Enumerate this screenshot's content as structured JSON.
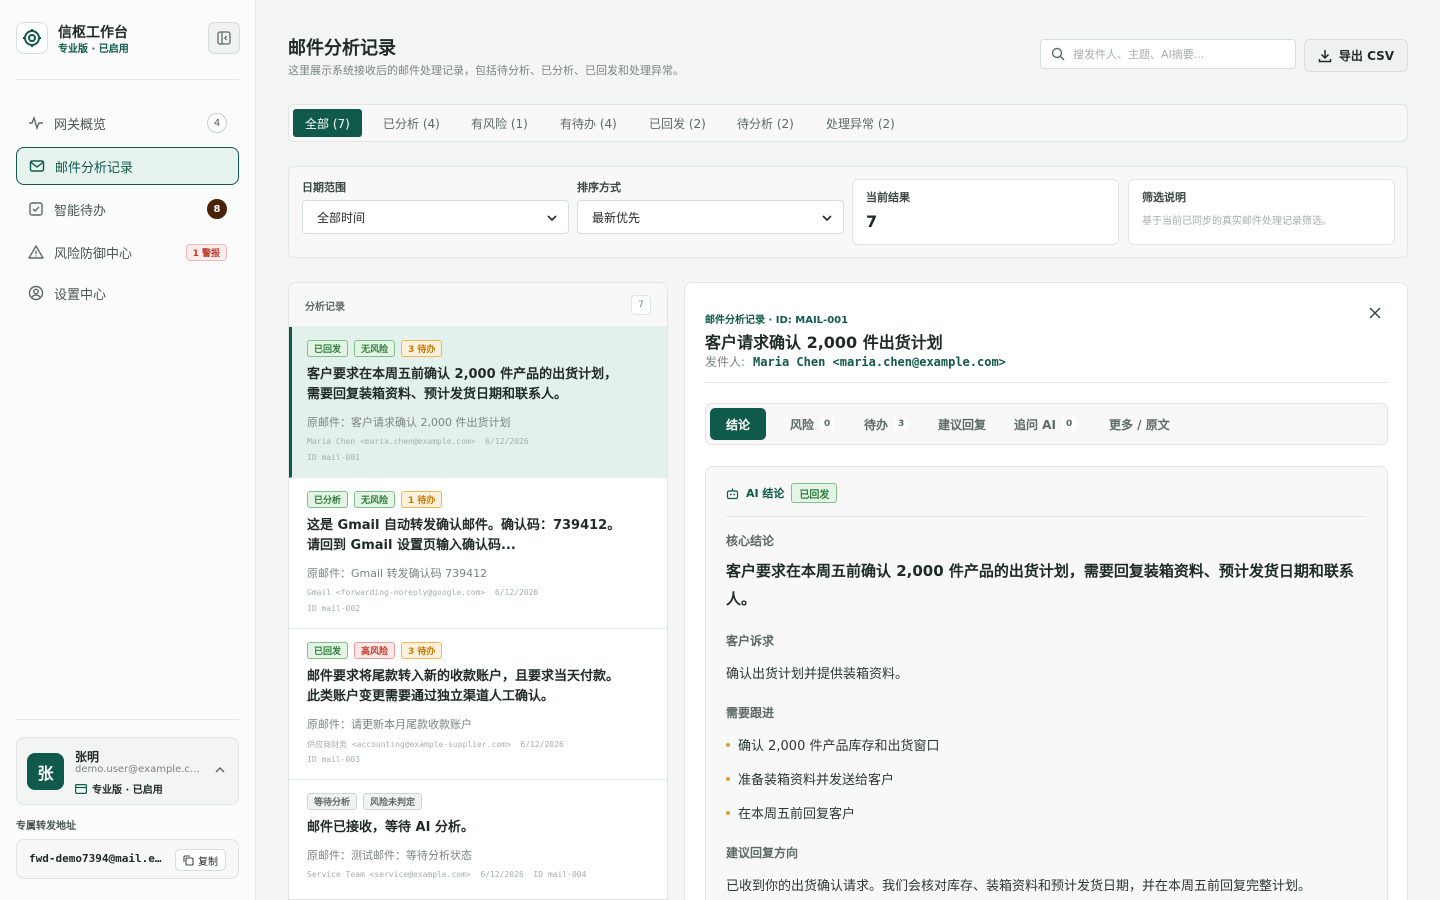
{
  "sidebar": {
    "brand_name": "信枢工作台",
    "brand_plan": "专业版 · 已启用",
    "nav": [
      {
        "label": "网关概览",
        "count": "4"
      },
      {
        "label": "邮件分析记录"
      },
      {
        "label": "智能待办",
        "count": "8"
      },
      {
        "label": "风险防御中心",
        "alert": "1 警报"
      },
      {
        "label": "设置中心"
      }
    ],
    "user": {
      "avatar": "张",
      "name": "张明",
      "email": "demo.user@example.com",
      "plan": "专业版 · 已启用"
    },
    "forward_label": "专属转发地址",
    "forward_address": "fwd-demo7394@mail.example.com",
    "copy_label": "复制"
  },
  "header": {
    "title": "邮件分析记录",
    "description": "这里展示系统接收后的邮件处理记录，包括待分析、已分析、已回发和处理异常。",
    "search_placeholder": "搜发件人、主题、AI摘要...",
    "export_label": "导出 CSV"
  },
  "tabs": [
    "全部 (7)",
    "已分析 (4)",
    "有风险 (1)",
    "有待办 (4)",
    "已回发 (2)",
    "待分析 (2)",
    "处理异常 (2)"
  ],
  "filters": {
    "date_label": "日期范围",
    "date_value": "全部时间",
    "sort_label": "排序方式",
    "sort_value": "最新优先",
    "result_label": "当前结果",
    "result_value": "7",
    "note_label": "筛选说明",
    "note_value": "基于当前已同步的真实邮件处理记录筛选。"
  },
  "list": {
    "title": "分析记录",
    "count": "7",
    "records": [
      {
        "badges": [
          "已回发",
          "无风险",
          "3 待办"
        ],
        "title": "客户要求在本周五前确认 2,000 件产品的出货计划，需要回复装箱资料、预计发货日期和联系人。",
        "original": "原邮件：客户请求确认 2,000 件出货计划",
        "sender": "Maria Chen <maria.chen@example.com>",
        "date": "6/12/2026",
        "id": "ID mail-001"
      },
      {
        "badges": [
          "已分析",
          "无风险",
          "1 待办"
        ],
        "title": "这是 Gmail 自动转发确认邮件。确认码：739412。请回到 Gmail 设置页输入确认码...",
        "original": "原邮件：Gmail 转发确认码 739412",
        "sender": "Gmail <forwarding-noreply@google.com>",
        "date": "6/12/2026",
        "id": "ID mail-002"
      },
      {
        "badges": [
          "已回发",
          "高风险",
          "3 待办"
        ],
        "title": "邮件要求将尾款转入新的收款账户，且要求当天付款。此类账户变更需要通过独立渠道人工确认。",
        "original": "原邮件：请更新本月尾款收款账户",
        "sender": "供应商财务 <accounting@example-supplier.com>",
        "date": "6/12/2026",
        "id": "ID mail-003"
      },
      {
        "badges": [
          "等待分析",
          "风险未判定"
        ],
        "title": "邮件已接收，等待 AI 分析。",
        "original": "原邮件：测试邮件：等待分析状态",
        "sender": "Service Team <service@example.com>",
        "date": "6/12/2026",
        "id": "ID mail-004"
      }
    ]
  },
  "detail": {
    "kicker": "邮件分析记录 · ID: MAIL-001",
    "title": "客户请求确认 2,000 件出货计划",
    "sender_label": "发件人:",
    "sender": "Maria Chen <maria.chen@example.com>",
    "tabs": [
      {
        "label": "结论"
      },
      {
        "label": "风险",
        "count": "0"
      },
      {
        "label": "待办",
        "count": "3"
      },
      {
        "label": "建议回复"
      },
      {
        "label": "追问 AI",
        "count": "0"
      },
      {
        "label": "更多 / 原文"
      }
    ],
    "ai_label": "AI 结论",
    "ai_status": "已回发",
    "core_label": "核心结论",
    "core": "客户要求在本周五前确认 2,000 件产品的出货计划，需要回复装箱资料、预计发货日期和联系人。",
    "appeal_label": "客户诉求",
    "appeal": "确认出货计划并提供装箱资料。",
    "followup_label": "需要跟进",
    "followups": [
      "确认 2,000 件产品库存和出货窗口",
      "准备装箱资料并发送给客户",
      "在本周五前回复客户"
    ],
    "reply_label": "建议回复方向",
    "reply": "已收到你的出货确认请求。我们会核对库存、装箱资料和预计发货日期，并在本周五前回复完整计划。"
  },
  "colors": {
    "accent": "#0f5a4a",
    "warning": "#e59a2b",
    "danger": "#c0392b"
  }
}
